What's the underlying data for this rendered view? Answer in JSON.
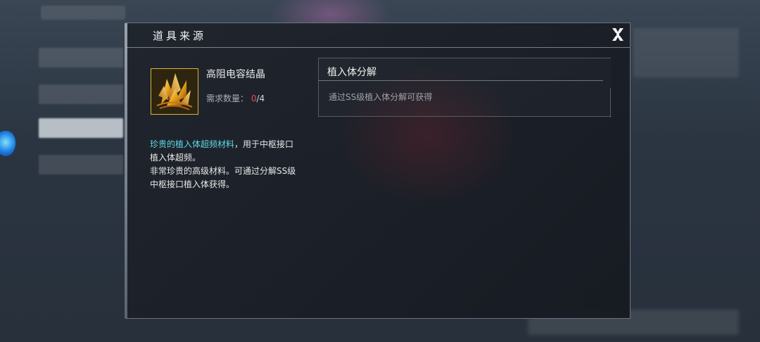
{
  "dialog": {
    "title": "道具来源",
    "close_label": "X"
  },
  "item": {
    "name": "高阻电容结晶",
    "requirement_label": "需求数量：",
    "requirement_current": "0",
    "requirement_total": "/4",
    "icon": "golden-crystal-icon",
    "description_highlight": "珍贵的植入体超频材料",
    "description_line1_rest": "，用于中枢接口植入体超频。",
    "description_line2": "非常珍贵的高级材料。可通过分解SS级中枢接口植入体获得。"
  },
  "source": {
    "title": "植入体分解",
    "text": "通过SS级植入体分解可获得"
  },
  "colors": {
    "highlight": "#5fd8e8",
    "requirement_current": "#e04f5f",
    "item_frame": "#d8b43a"
  }
}
